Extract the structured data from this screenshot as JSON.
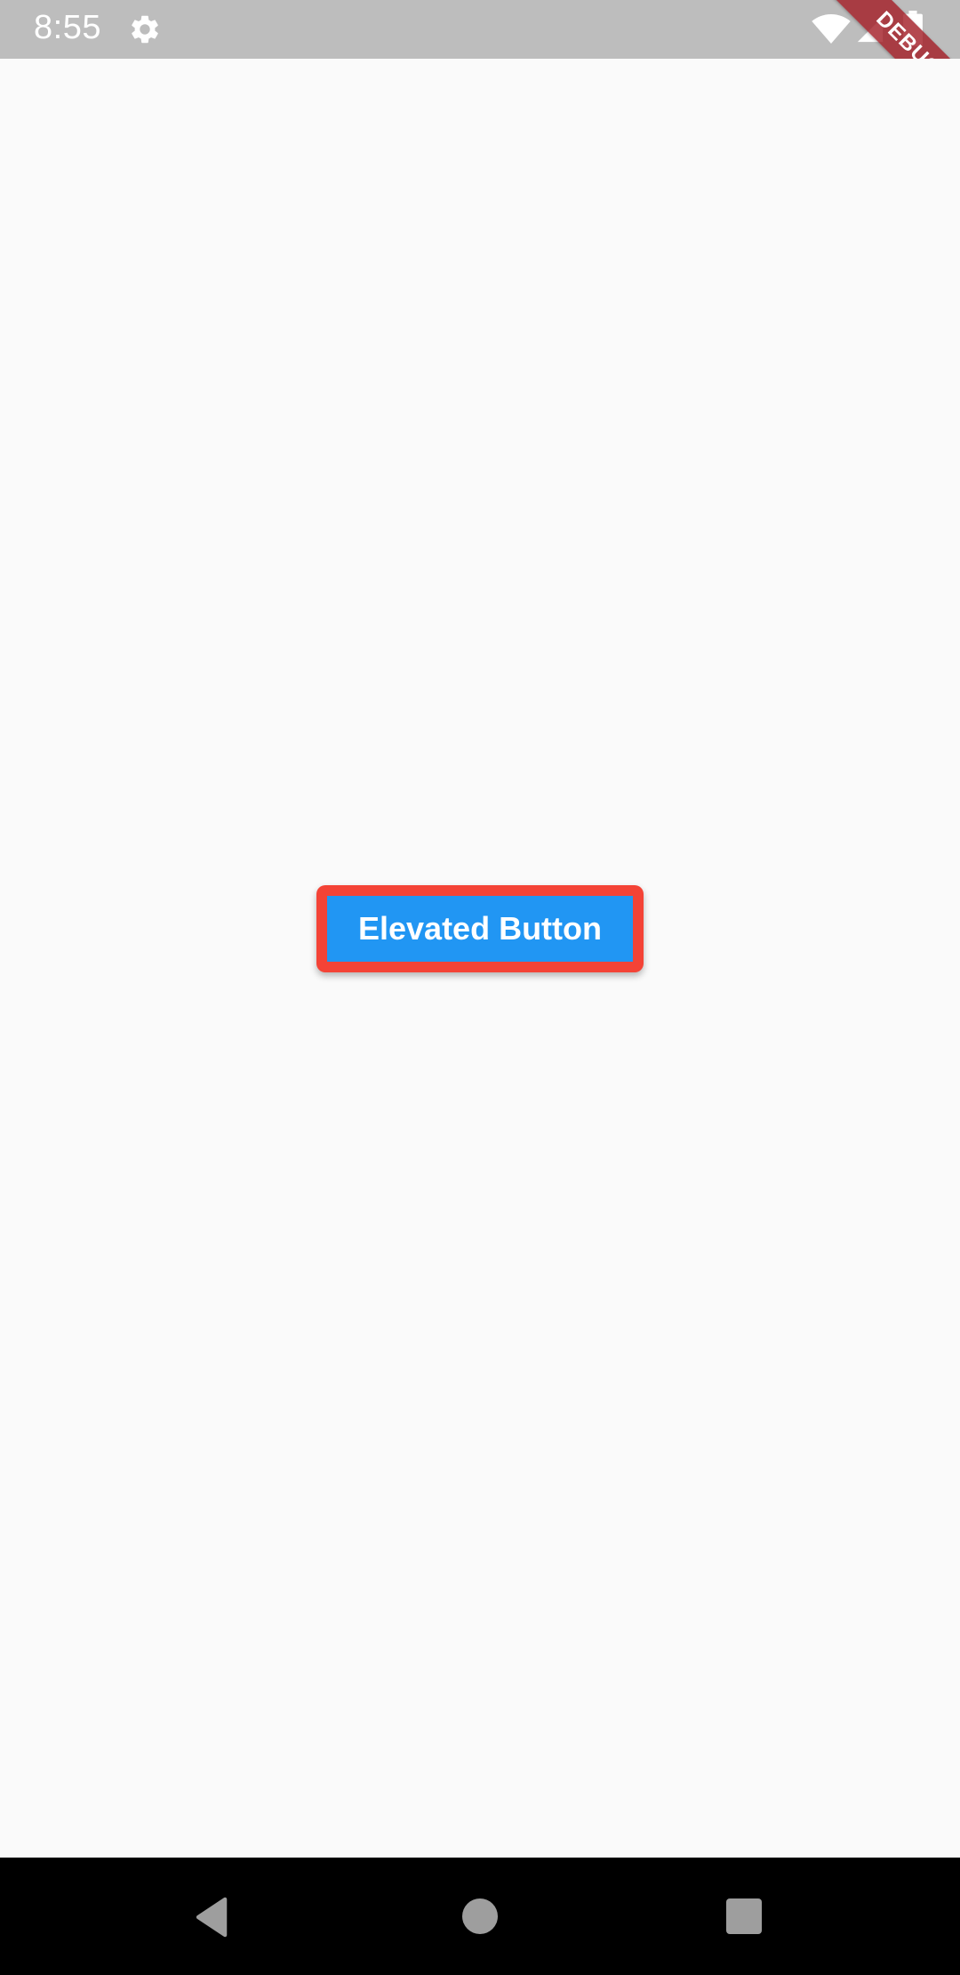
{
  "status_bar": {
    "time": "8:55",
    "icons": [
      "gear-icon",
      "wifi-icon",
      "signal-icon",
      "battery-icon"
    ]
  },
  "debug_banner": {
    "label": "DEBUG"
  },
  "main": {
    "button_label": "Elevated Button"
  },
  "nav_bar": {
    "icons": [
      "back-icon",
      "home-icon",
      "recents-icon"
    ]
  },
  "colors": {
    "status_bar": "#bdbdbd",
    "background": "#fafafa",
    "button_fill": "#2196f3",
    "button_border": "#f44336",
    "debug_banner": "#a42028",
    "nav_bar": "#000000",
    "nav_icons": "#9e9e9e"
  }
}
